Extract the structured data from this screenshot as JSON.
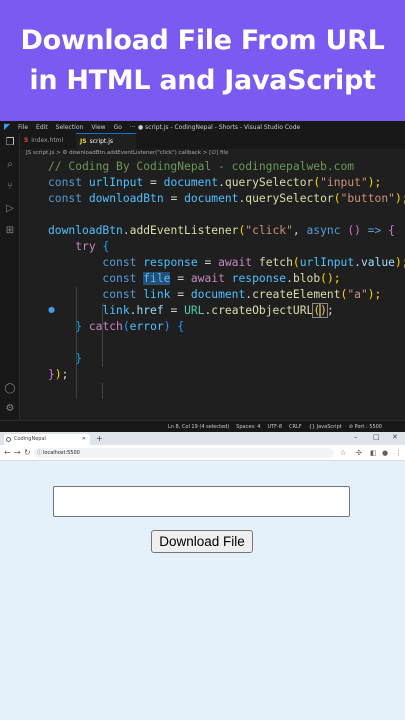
{
  "banner": {
    "line1": "Download File From URL",
    "line2": "in HTML and JavaScript"
  },
  "vscode": {
    "title": "● script.js - CodingNepal - Shorts - Visual Studio Code",
    "menu": [
      "File",
      "Edit",
      "Selection",
      "View",
      "Go",
      "···"
    ],
    "tabs": [
      {
        "label": "index.html",
        "icon": "html-file-icon",
        "icon_glyph": "5",
        "icon_color": "#e44d26"
      },
      {
        "label": "script.js",
        "icon": "js-file-icon",
        "icon_glyph": "JS",
        "icon_color": "#f1dd35"
      }
    ],
    "breadcrumb": "JS script.js > ⚙ downloadBtn.addEventListener(\"click\") callback > [∅] file",
    "code": {
      "line1": "// Coding By CodingNepal - codingnepalweb.com",
      "line2": [
        "const",
        " ",
        "urlInput",
        " = ",
        "document",
        ".",
        "querySelector",
        "(",
        "\"input\"",
        ");"
      ],
      "line3": [
        "const",
        " ",
        "downloadBtn",
        " = ",
        "document",
        ".",
        "querySelector",
        "(",
        "\"button\"",
        ");"
      ],
      "line5": [
        "downloadBtn",
        ".",
        "addEventListener",
        "(",
        "\"click\"",
        ", ",
        "async",
        " ",
        "()",
        " => ",
        "{"
      ],
      "line6": [
        "try",
        " ",
        "{"
      ],
      "line7": [
        "const",
        " ",
        "response",
        " = ",
        "await",
        " ",
        "fetch",
        "(",
        "urlInput",
        ".",
        "value",
        ");"
      ],
      "line8": [
        "const",
        " ",
        "file",
        " = ",
        "await",
        " ",
        "response",
        ".",
        "blob",
        "();"
      ],
      "line9": [
        "const",
        " ",
        "link",
        " = ",
        "document",
        ".",
        "createElement",
        "(",
        "\"a\"",
        ");"
      ],
      "line10": [
        "link",
        ".",
        "href",
        " = ",
        "URL",
        ".",
        "createObjectURL",
        "(",
        ")",
        ";"
      ],
      "line11": [
        "}",
        " ",
        "catch",
        "(",
        "error",
        ")",
        " ",
        "{"
      ],
      "line13": [
        "}"
      ],
      "line14": [
        "}",
        ")",
        ";"
      ]
    },
    "status": {
      "position": "Ln 8, Col 19 (4 selected)",
      "spaces": "Spaces: 4",
      "encoding": "UTF-8",
      "eol": "CRLF",
      "language": "{} JavaScript",
      "port": "⊘ Port : 5500"
    }
  },
  "browser": {
    "tab_title": "CodingNepal",
    "url": "localhost:5500",
    "download_button_label": "Download File",
    "input_value": ""
  },
  "colors": {
    "banner": "#7a5af0",
    "editor_bg": "#1f1f1f",
    "page_bg": "#e4f1fb",
    "selection": "#264f78"
  }
}
